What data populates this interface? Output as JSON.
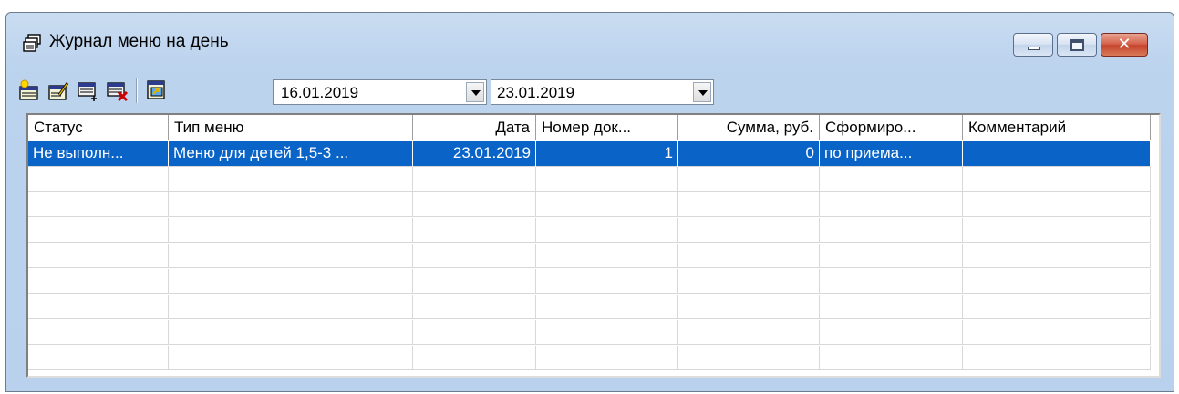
{
  "window": {
    "title": "Журнал меню на день",
    "icon": "journal-stack-icon",
    "controls": [
      "minimize-icon",
      "maximize-icon",
      "close-icon"
    ],
    "close_symbol": "✕"
  },
  "toolbar": {
    "buttons": [
      {
        "name": "new-document-button",
        "icon": "new-document-icon"
      },
      {
        "name": "edit-document-button",
        "icon": "edit-document-icon"
      },
      {
        "name": "add-row-button",
        "icon": "add-row-icon"
      },
      {
        "name": "delete-document-button",
        "icon": "delete-document-icon"
      },
      {
        "name": "export-button",
        "icon": "export-icon"
      }
    ],
    "date_from": "16.01.2019",
    "date_to": "23.01.2019"
  },
  "grid": {
    "columns": [
      "Статус",
      "Тип меню",
      "Дата",
      "Номер док...",
      "Сумма, руб.",
      "Сформиро...",
      "Комментарий"
    ],
    "rows": [
      [
        "Не выполн...",
        "Меню для детей 1,5-3 ...",
        "23.01.2019",
        "1",
        "0",
        "по приема...",
        ""
      ]
    ],
    "selected_row": 0,
    "empty_rows": 8
  },
  "colors": {
    "selection": "#0a64c8",
    "window_frame": "#bcd3ee",
    "close_button": "#c5452d"
  }
}
